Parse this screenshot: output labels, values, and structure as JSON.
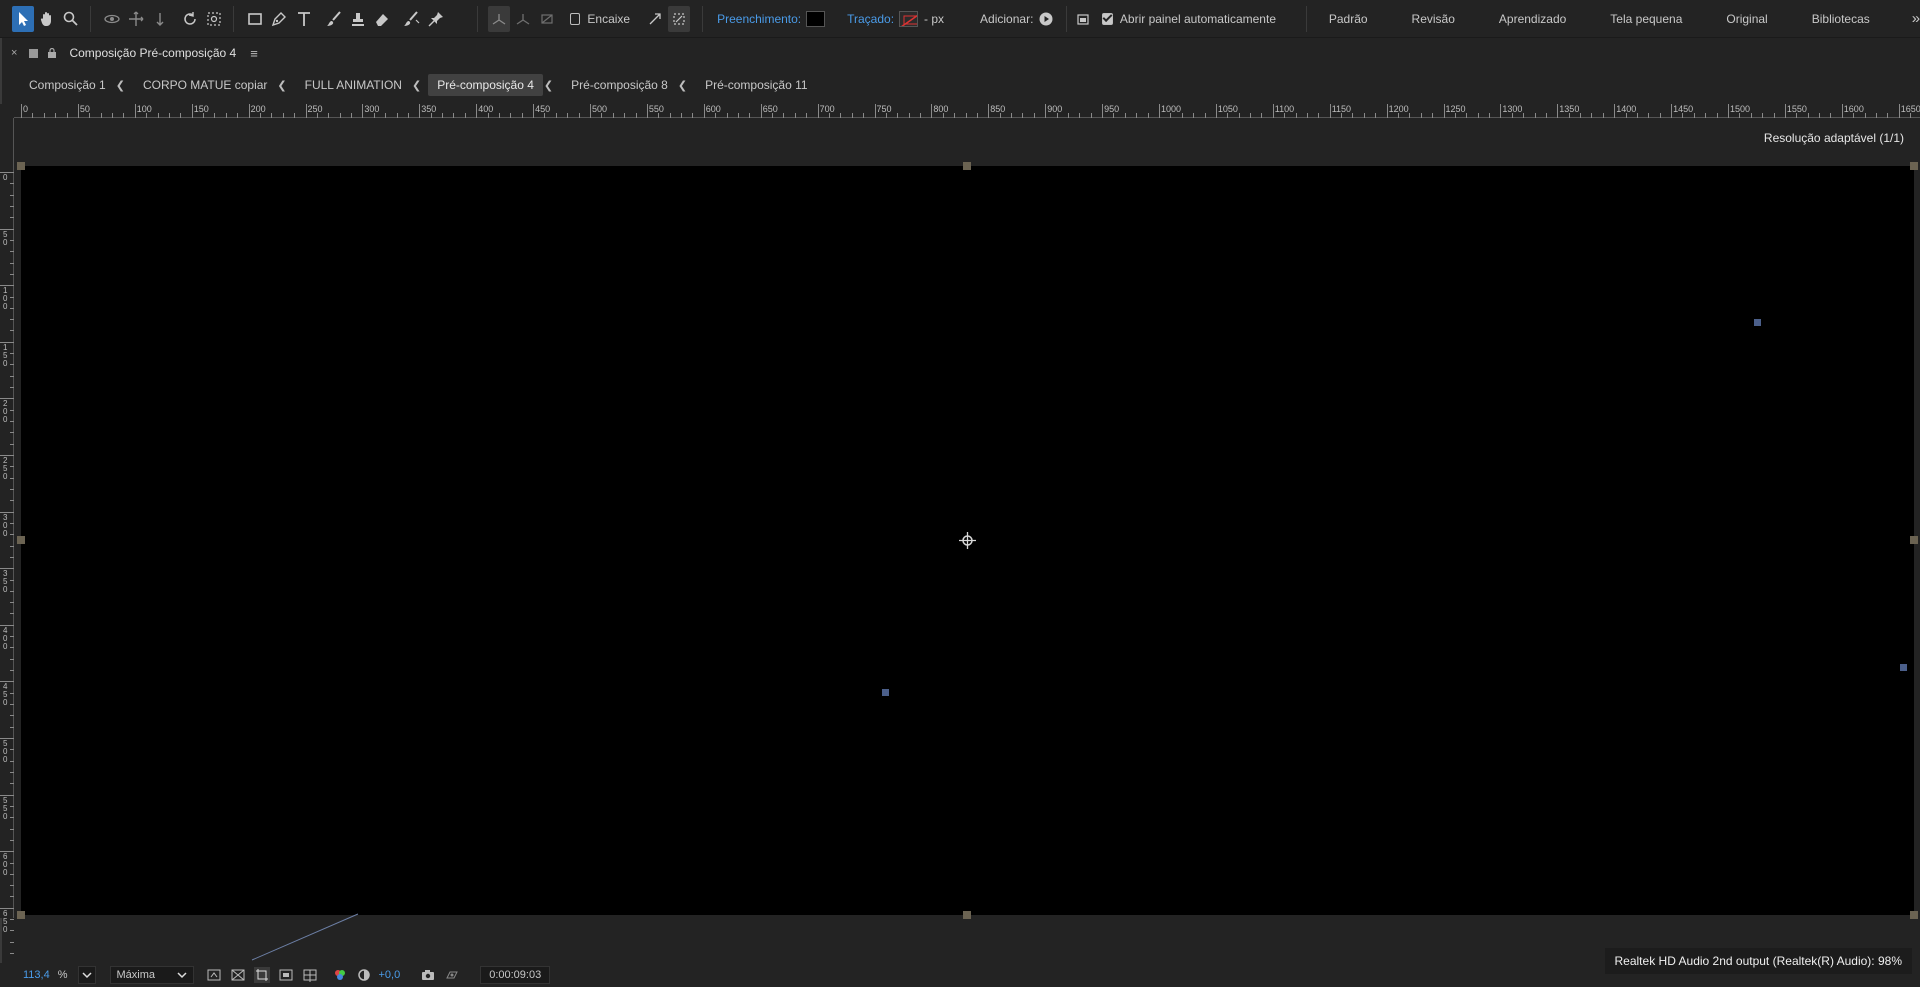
{
  "toolbar": {
    "snap_label": "Encaixe",
    "fill_label": "Preenchimento:",
    "stroke_label": "Traçado:",
    "stroke_unit": "- px",
    "add_label": "Adicionar:",
    "auto_open_label": "Abrir painel automaticamente",
    "fill_color": "#000000",
    "accent_color": "#2d6fb5"
  },
  "workspaces": [
    "Padrão",
    "Revisão",
    "Aprendizado",
    "Tela pequena",
    "Original",
    "Bibliotecas"
  ],
  "workspace_more": "»",
  "panel": {
    "close": "×",
    "title": "Composição Pré-composição 4",
    "menu": "≡"
  },
  "breadcrumb": [
    "Composição 1",
    "CORPO MATUE copiar",
    "FULL ANIMATION",
    "Pré-composição 4",
    "Pré-composição 8",
    "Pré-composição 11"
  ],
  "active_breadcrumb": "Pré-composição 4",
  "ruler": {
    "h_labels": [
      "0",
      "50",
      "100",
      "150",
      "200",
      "250",
      "300",
      "350",
      "400",
      "450",
      "500",
      "550",
      "600",
      "650",
      "700",
      "750",
      "800",
      "850",
      "900",
      "950",
      "1000",
      "1050",
      "1100",
      "1150",
      "1200",
      "1250",
      "1300",
      "1350",
      "1400",
      "1450",
      "1500",
      "1550",
      "1600",
      "1650"
    ],
    "v_labels": [
      "0",
      "50",
      "100",
      "150",
      "200",
      "250",
      "300",
      "350",
      "400",
      "450",
      "500",
      "550",
      "600",
      "650"
    ]
  },
  "viewer": {
    "resolution_label": "Resolução adaptável (1/1)"
  },
  "bottom": {
    "zoom_value": "113,4",
    "zoom_unit": "%",
    "quality": "Máxima",
    "exposure": "+0,0",
    "timecode": "0:00:09:03"
  },
  "toast": "Realtek HD Audio 2nd output (Realtek(R) Audio): 98%"
}
